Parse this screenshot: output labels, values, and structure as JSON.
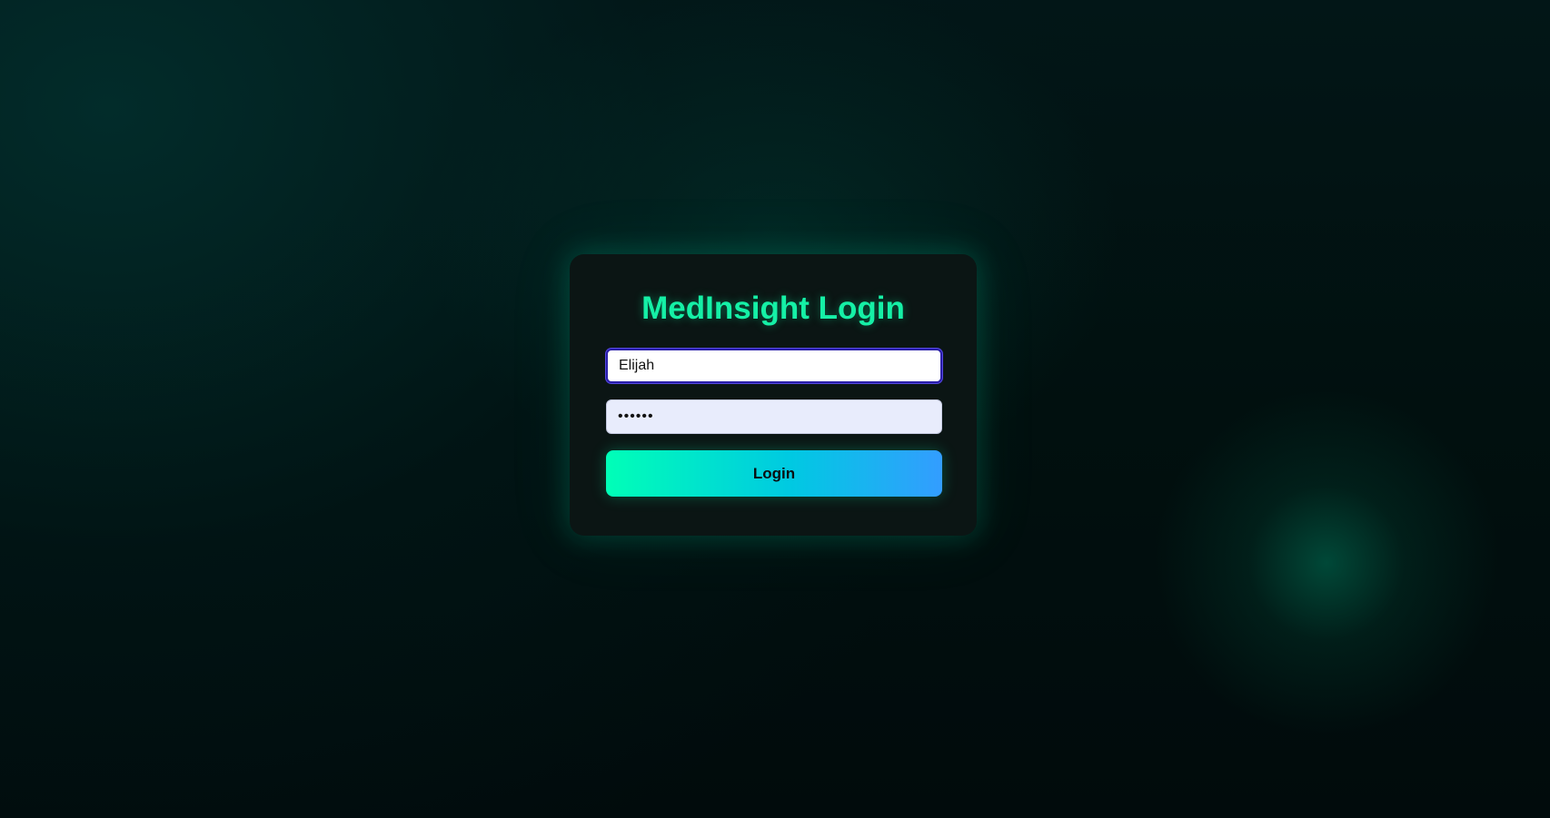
{
  "login": {
    "title": "MedInsight Login",
    "username_value": "Elijah",
    "password_value": "123456",
    "login_button_label": "Login"
  },
  "colors": {
    "accent_green": "#15f0a6",
    "button_gradient_start": "#00ffb7",
    "button_gradient_end": "#339dff",
    "background": "#010a0c",
    "card": "#0b1514",
    "focus_border": "#2a1ea8"
  }
}
